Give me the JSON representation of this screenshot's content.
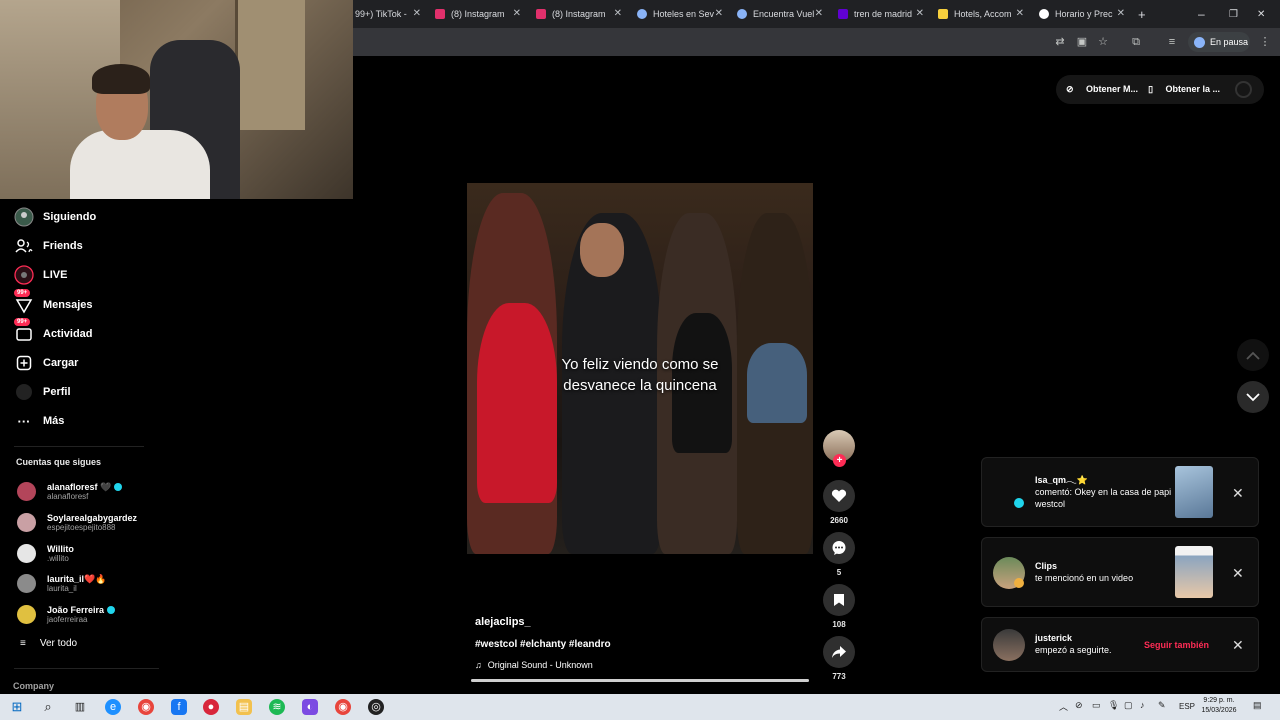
{
  "browser": {
    "tabs": [
      {
        "title": "99+) TikTok - ",
        "favicon": "tiktok-icon",
        "color": "#000000"
      },
      {
        "title": "(8) Instagram",
        "favicon": "instagram-icon",
        "color": "#e1306c"
      },
      {
        "title": "(8) Instagram",
        "favicon": "instagram-icon",
        "color": "#e1306c"
      },
      {
        "title": "Hoteles en Sev",
        "favicon": "globe-icon",
        "color": "#8ab4f8"
      },
      {
        "title": "Encuentra Vuel",
        "favicon": "globe-icon",
        "color": "#8ab4f8"
      },
      {
        "title": "tren de madrid",
        "favicon": "yahoo-icon",
        "color": "#6001d2"
      },
      {
        "title": "Hotels, Accom",
        "favicon": "booking-icon",
        "color": "#f7d03d"
      },
      {
        "title": "Horario y Prec",
        "favicon": "train-icon",
        "color": "#ffffff"
      }
    ],
    "new_tab": "+",
    "profile_label": "En pausa"
  },
  "sidebar": {
    "items": [
      {
        "label": "Siguiendo",
        "icon": "following-icon"
      },
      {
        "label": "Friends",
        "icon": "friends-icon"
      },
      {
        "label": "LIVE",
        "icon": "live-icon"
      },
      {
        "label": "Mensajes",
        "icon": "messages-icon",
        "badge": "99+"
      },
      {
        "label": "Actividad",
        "icon": "activity-icon",
        "badge": "99+"
      },
      {
        "label": "Cargar",
        "icon": "upload-icon"
      },
      {
        "label": "Perfil",
        "icon": "profile-icon"
      },
      {
        "label": "Más",
        "icon": "more-icon"
      }
    ],
    "following_title": "Cuentas que sigues",
    "accounts": [
      {
        "name": "alanafloresf 🖤",
        "handle": "alanafloresf",
        "verified": true,
        "color": "#b3455a"
      },
      {
        "name": "Soylarealgabygardez",
        "handle": "espejitoespejito888",
        "verified": false,
        "color": "#c9a0a4"
      },
      {
        "name": "Willito",
        "handle": ".willito",
        "verified": false,
        "color": "#e6e6e6"
      },
      {
        "name": "laurita_il❤️🔥",
        "handle": "laurita_il",
        "verified": false,
        "color": "#8b8b8b"
      },
      {
        "name": "João Ferreira",
        "handle": "jaoferreiraa",
        "verified": true,
        "color": "#e0c040"
      }
    ],
    "see_all": "Ver todo",
    "company": "Company"
  },
  "top_actions": {
    "get_app_1": "Obtener M...",
    "get_app_2": "Obtener la ..."
  },
  "video": {
    "caption_line1": "Yo feliz viendo como se",
    "caption_line2": "desvanece la quincena",
    "author": "alejaclips_",
    "hashtags": "#westcol #elchanty #leandro",
    "sound": "Original Sound - Unknown",
    "progress": 1.0
  },
  "actions": {
    "likes": "2660",
    "comments": "5",
    "saves": "108",
    "shares": "773"
  },
  "notifications": [
    {
      "user": "Isa_qm𓂃⭐",
      "text": "comentó: Okey en la casa de papi westcol"
    },
    {
      "user": "Clips",
      "text": "te mencionó en un video"
    },
    {
      "user": "justerick",
      "text": "empezó a seguirte.",
      "action": "Seguir también"
    }
  ],
  "taskbar": {
    "language": "ESP",
    "time": "9:29 p. m.",
    "date": "15/03/2026"
  }
}
